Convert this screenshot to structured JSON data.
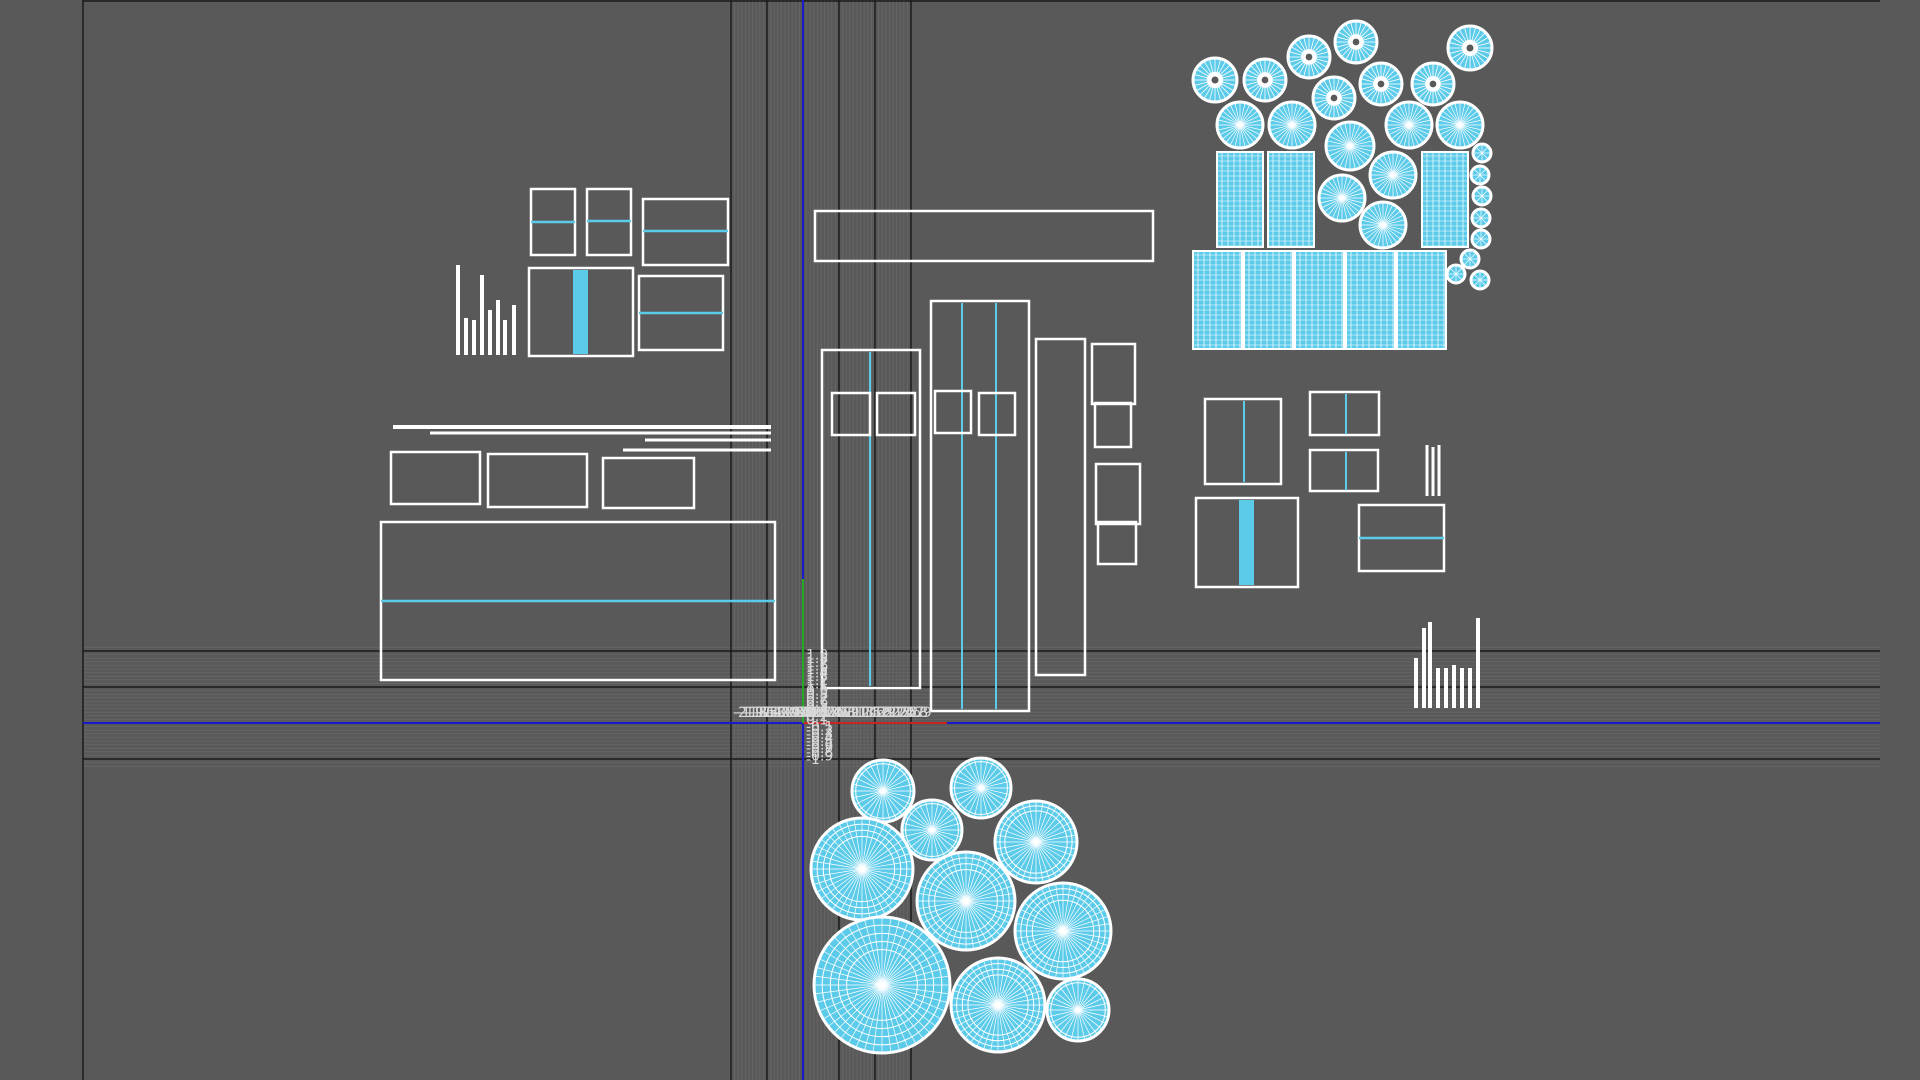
{
  "app": {
    "view": "UV Texture Editor"
  },
  "colors": {
    "background": "#595959",
    "grid_minor": "#656565",
    "grid_major": "#1a1a1a",
    "u_axis": "#1a1acc",
    "v_axis": "#1a1acc",
    "u_axis_origin": "#cc2222",
    "v_axis_origin": "#22aa22",
    "shell_outline": "#ffffff",
    "shell_fill": "#5ccbea",
    "tick_label": "#d8d8d8"
  },
  "axes": {
    "u_range": [
      -2,
      2.9
    ],
    "v_range": [
      -1,
      1.9
    ],
    "u_tick_labels": [
      "-2",
      "-1.9",
      "-1.8",
      "-1.7",
      "-1.6",
      "-1.5",
      "-1.4",
      "-1.3",
      "-1.2",
      "-1.1",
      "-1",
      "-0.9",
      "-0.8",
      "-0.7",
      "-0.6",
      "-0.5",
      "-0.4",
      "-0.3",
      "-0.2",
      "-0.1",
      "0",
      "0.1",
      "0.2",
      "0.3",
      "0.4",
      "0.5",
      "0.6",
      "0.7",
      "0.8",
      "0.9",
      "1",
      "1.1",
      "1.2",
      "1.3",
      "1.4",
      "1.5",
      "1.6",
      "1.7",
      "1.8",
      "1.9",
      "2",
      "2.1",
      "2.2",
      "2.3",
      "2.4",
      "2.5",
      "2.6",
      "2.7",
      "2.8",
      "2.9"
    ],
    "v_tick_labels": [
      "1.9",
      "1.8",
      "1.7",
      "1.6",
      "1.5",
      "1.4",
      "1.3",
      "1.2",
      "1.1",
      "1",
      "0.9",
      "0.8",
      "0.7",
      "0.6",
      "0.5",
      "0.4",
      "0.3",
      "0.2",
      "0.1",
      "-0.1",
      "-0.2",
      "-0.3",
      "-0.4",
      "-0.5",
      "-0.6",
      "-0.7",
      "-0.8",
      "-0.9",
      "-1"
    ],
    "major_grid_step": 1,
    "minor_grid_step": 0.1,
    "grid": true
  }
}
